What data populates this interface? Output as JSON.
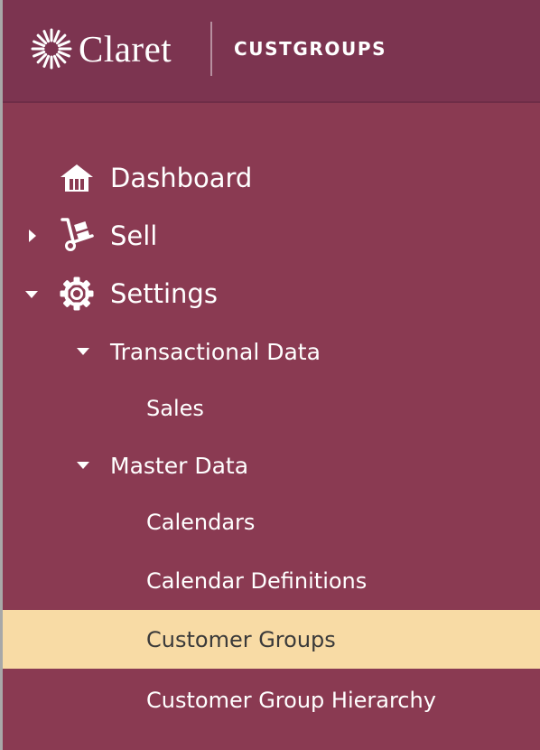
{
  "header": {
    "logo_text": "Claret",
    "app_name": "CUSTGROUPS"
  },
  "colors": {
    "sidebar_bg": "#8a3a52",
    "header_bg": "#7c3450",
    "selected_bg": "#f8dba5",
    "text": "#ffffff"
  },
  "nav": {
    "dashboard": {
      "label": "Dashboard",
      "icon": "home-icon"
    },
    "sell": {
      "label": "Sell",
      "icon": "hand-truck-icon",
      "expanded": false
    },
    "settings": {
      "label": "Settings",
      "icon": "gear-icon",
      "expanded": true
    },
    "transactional": {
      "label": "Transactional Data",
      "expanded": true
    },
    "sales": {
      "label": "Sales"
    },
    "master": {
      "label": "Master Data",
      "expanded": true
    },
    "calendars": {
      "label": "Calendars"
    },
    "calendar_definitions": {
      "label": "Calendar Definitions"
    },
    "customer_groups": {
      "label": "Customer Groups",
      "selected": true
    },
    "customer_group_hierarchy": {
      "label": "Customer Group Hierarchy"
    }
  }
}
